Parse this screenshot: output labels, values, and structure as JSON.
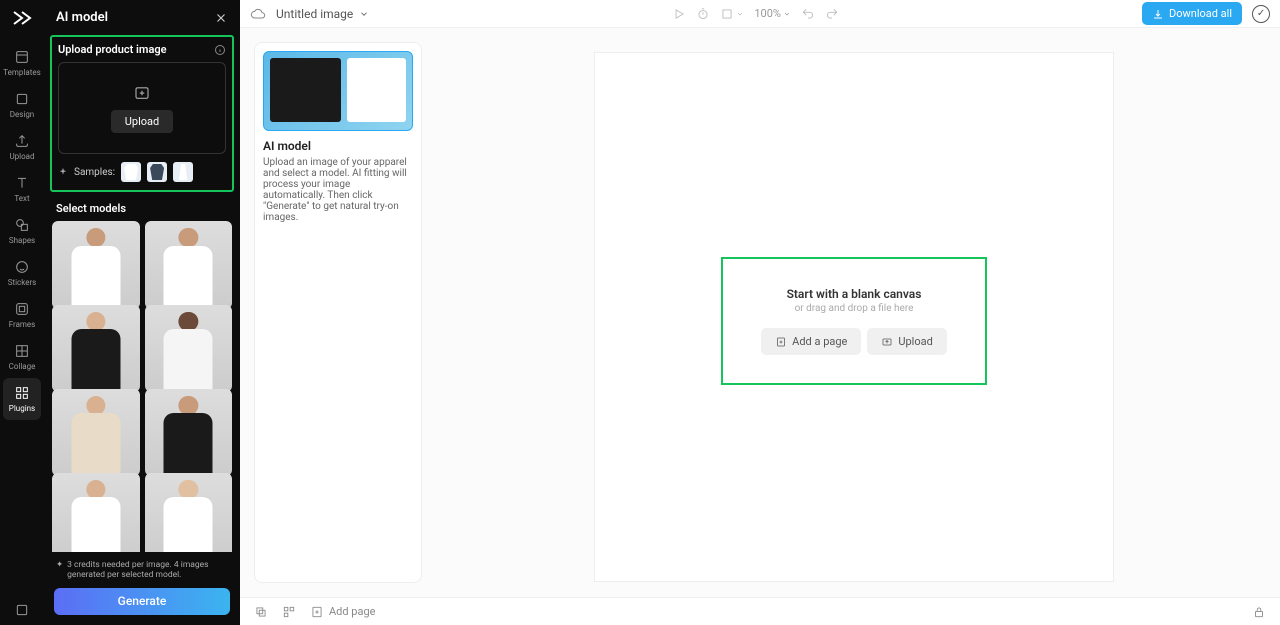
{
  "rail": {
    "items": [
      {
        "label": "Templates"
      },
      {
        "label": "Design"
      },
      {
        "label": "Upload"
      },
      {
        "label": "Text"
      },
      {
        "label": "Shapes"
      },
      {
        "label": "Stickers"
      },
      {
        "label": "Frames"
      },
      {
        "label": "Collage"
      },
      {
        "label": "Plugins"
      }
    ]
  },
  "panel": {
    "title": "AI model",
    "upload_title": "Upload product image",
    "upload_btn": "Upload",
    "samples_label": "Samples:",
    "select_models": "Select models",
    "credits": "3 credits needed per image. 4 images generated per selected model.",
    "generate": "Generate"
  },
  "card": {
    "title": "AI model",
    "desc": "Upload an image of your apparel and select a model. AI fitting will process your image automatically. Then click \"Generate\" to get natural try-on images."
  },
  "topbar": {
    "doc_title": "Untitled image",
    "zoom": "100%",
    "download": "Download all"
  },
  "empty": {
    "title": "Start with a blank canvas",
    "sub": "or drag and drop a file here",
    "add_page": "Add a page",
    "upload": "Upload"
  },
  "bottom": {
    "add_page": "Add page"
  }
}
